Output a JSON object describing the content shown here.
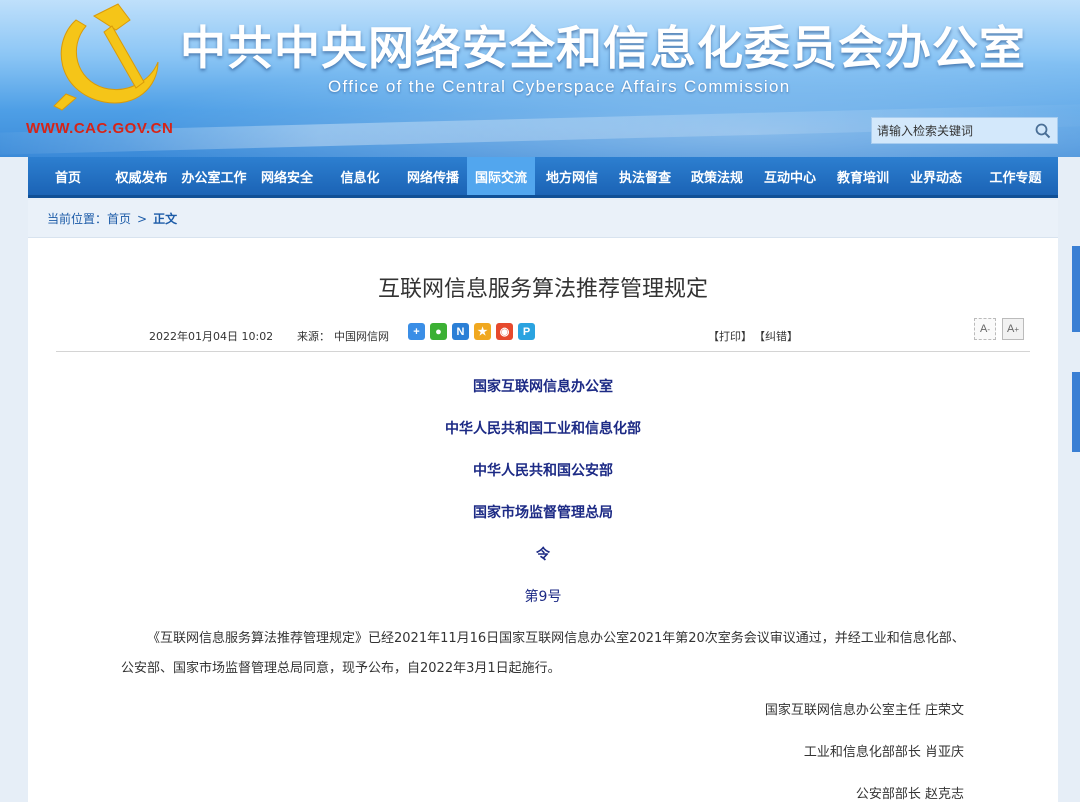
{
  "header": {
    "title": "中共中央网络安全和信息化委员会办公室",
    "subtitle": "Office of the Central Cyberspace Affairs Commission",
    "url": "WWW.CAC.GOV.CN",
    "emblem_icon": "party-emblem-icon",
    "colors": {
      "title": "#ffffff",
      "url": "#d62418",
      "emblem": "#f5c518"
    }
  },
  "search": {
    "placeholder": "请输入检索关键词",
    "icon": "search-icon"
  },
  "nav": {
    "active_color": "#52a6ee",
    "bar_color": "#1b63b5",
    "items": [
      {
        "label": "首页"
      },
      {
        "label": "权威发布"
      },
      {
        "label": "办公室工作"
      },
      {
        "label": "网络安全"
      },
      {
        "label": "信息化"
      },
      {
        "label": "网络传播"
      },
      {
        "label": "国际交流",
        "active": true
      },
      {
        "label": "地方网信"
      },
      {
        "label": "执法督查"
      },
      {
        "label": "政策法规"
      },
      {
        "label": "互动中心"
      },
      {
        "label": "教育培训"
      },
      {
        "label": "业界动态"
      },
      {
        "label": "工作专题"
      }
    ]
  },
  "breadcrumb": {
    "prefix": "当前位置：",
    "home": "首页",
    "separator": ">",
    "current": "正文"
  },
  "article": {
    "title": "互联网信息服务算法推荐管理规定",
    "date": "2022年01月04日 10:02",
    "source_label": "来源：",
    "source": "中国网信网",
    "share_icons": [
      {
        "name": "share-more-icon",
        "glyph": "+",
        "color": "#3a8ee6"
      },
      {
        "name": "wechat-icon",
        "glyph": "●",
        "color": "#3cb034"
      },
      {
        "name": "news-icon",
        "glyph": "N",
        "color": "#2b7fd6"
      },
      {
        "name": "qzone-icon",
        "glyph": "★",
        "color": "#f0a820"
      },
      {
        "name": "weibo-icon",
        "glyph": "◉",
        "color": "#e6492d"
      },
      {
        "name": "tencent-icon",
        "glyph": "P",
        "color": "#2aa3e0"
      }
    ],
    "print": "【打印】",
    "correct": "【纠错】",
    "font_small": "A",
    "font_large": "A",
    "issuers": [
      "国家互联网信息办公室",
      "中华人民共和国工业和信息化部",
      "中华人民共和国公安部",
      "国家市场监督管理总局",
      "令",
      "第9号"
    ],
    "paragraph": "《互联网信息服务算法推荐管理规定》已经2021年11月16日国家互联网信息办公室2021年第20次室务会议审议通过，并经工业和信息化部、公安部、国家市场监督管理总局同意，现予公布，自2022年3月1日起施行。",
    "signatures": [
      "国家互联网信息办公室主任  庄荣文",
      "工业和信息化部部长  肖亚庆",
      "公安部部长  赵克志"
    ]
  }
}
